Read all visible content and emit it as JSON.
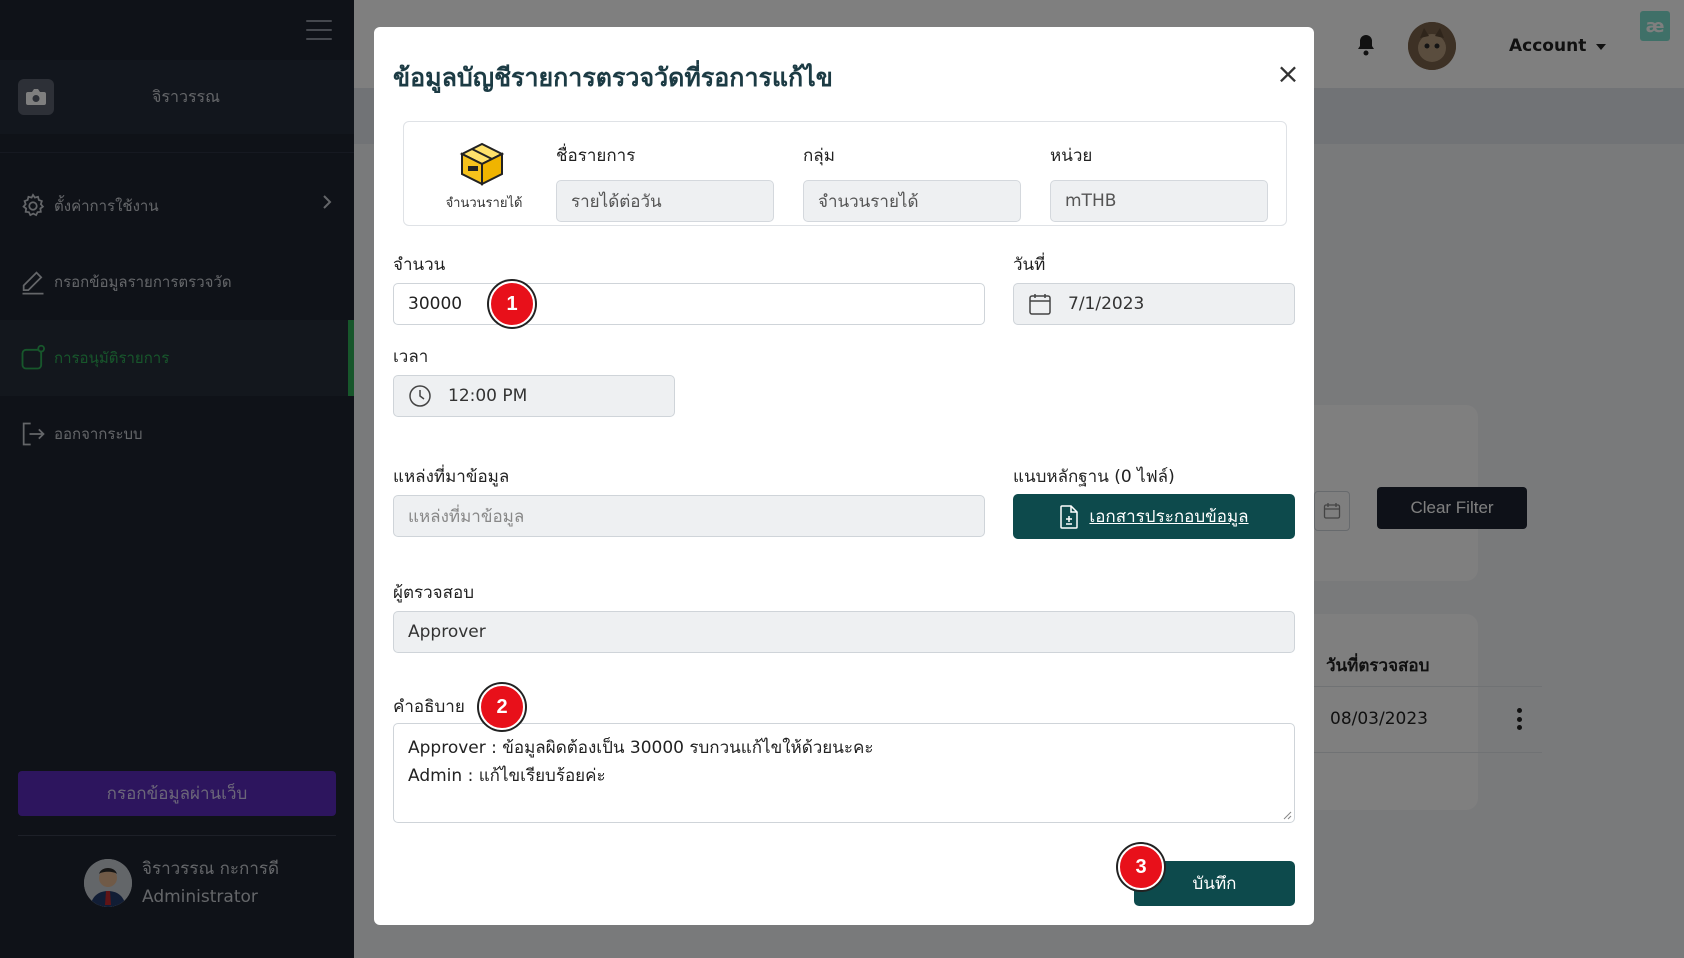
{
  "sidebar": {
    "org_name": "จิราวรรณ",
    "menu": [
      {
        "label": "ตั้งค่าการใช้งาน",
        "icon": "gear-icon"
      },
      {
        "label": "กรอกข้อมูลรายการตรวจวัด",
        "icon": "pencil-icon"
      },
      {
        "label": "การอนุมัติรายการ",
        "icon": "approval-icon"
      },
      {
        "label": "ออกจากระบบ",
        "icon": "logout-icon"
      }
    ],
    "web_button": "กรอกข้อมูลผ่านเว็บ",
    "user_name": "จิราวรรณ กะการดี",
    "user_role": "Administrator"
  },
  "topbar": {
    "account_label": "Account",
    "logo_text": "æ"
  },
  "background": {
    "clear_filter": "Clear Filter",
    "table_header_date": "วันที่ตรวจสอบ",
    "table_row_date": "08/03/2023"
  },
  "modal": {
    "title": "ข้อมูลบัญชีรายการตรวจวัดที่รอการแก้ไข",
    "close_symbol": "×",
    "item_caption": "จำนวนรายได้",
    "name_label": "ชื่อรายการ",
    "name_value": "รายได้ต่อวัน",
    "group_label": "กลุ่ม",
    "group_value": "จำนวนรายได้",
    "unit_label": "หน่วย",
    "unit_value": "mTHB",
    "amount_label": "จำนวน",
    "amount_value": "30000",
    "date_label": "วันที่",
    "date_value": "7/1/2023",
    "time_label": "เวลา",
    "time_value": "12:00 PM",
    "source_label": "แหล่งที่มาข้อมูล",
    "source_placeholder": "แหล่งที่มาข้อมูล",
    "attach_label": "แนบหลักฐาน (0 ไฟล์)",
    "attach_button": "เอกสารประกอบข้อมูล",
    "reviewer_label": "ผู้ตรวจสอบ",
    "reviewer_value": "Approver",
    "desc_label": "คำอธิบาย",
    "desc_line1": "Approver : ข้อมูลผิดต้องเป็น 30000 รบกวนแก้ไขให้ด้วยนะคะ",
    "desc_line2": "Admin : แก้ไขเรียบร้อยค่ะ",
    "save_button": "บันทึก"
  },
  "badges": [
    "1",
    "2",
    "3"
  ],
  "colors": {
    "sidebar_bg": "#1e2431",
    "active_green": "#2fae57",
    "web_button": "#5b2bbd",
    "primary_teal": "#0d4a4c",
    "badge_red": "#e8101a"
  }
}
